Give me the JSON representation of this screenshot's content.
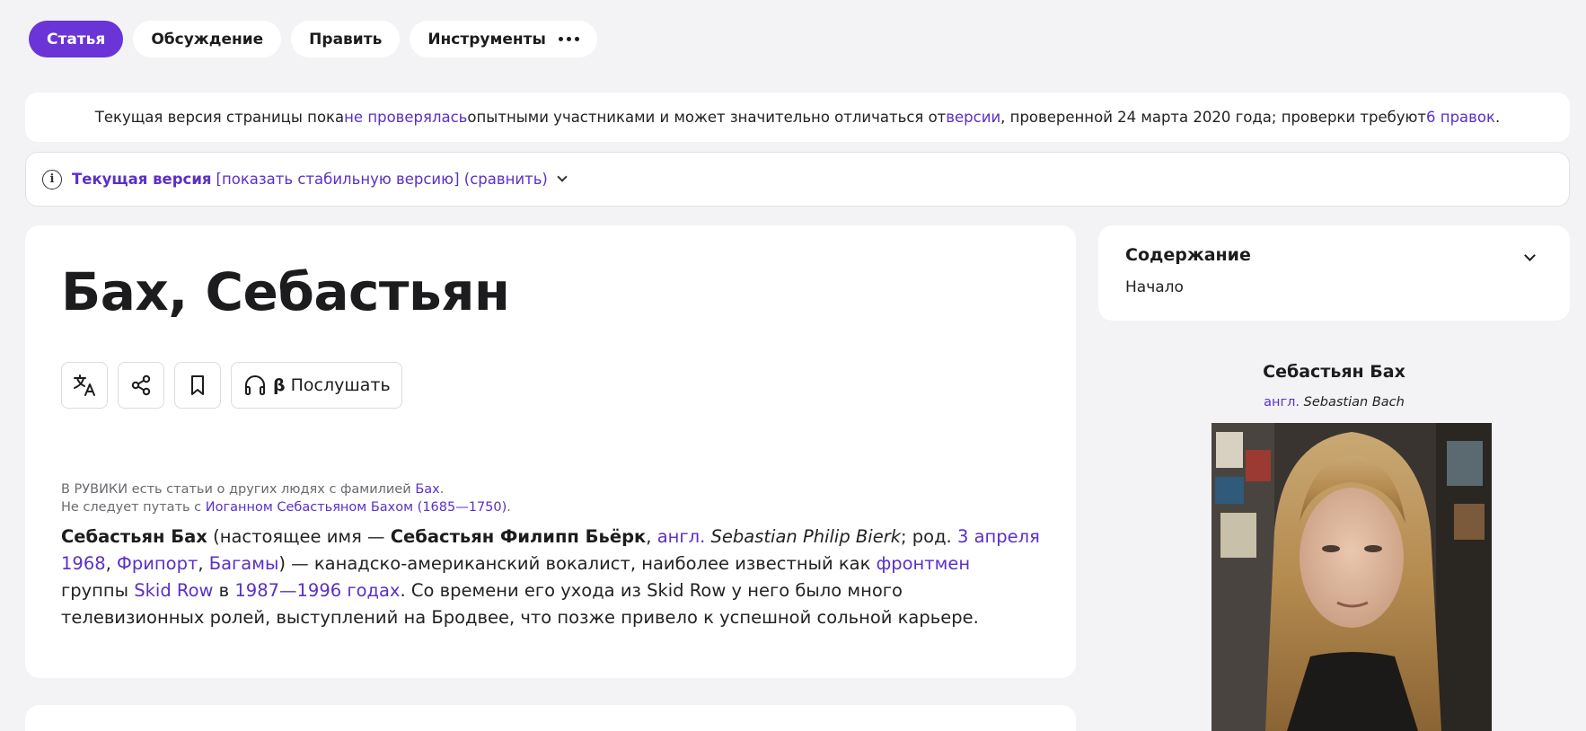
{
  "tabs": [
    {
      "label": "Статья",
      "active": true
    },
    {
      "label": "Обсуждение",
      "active": false
    },
    {
      "label": "Править",
      "active": false
    },
    {
      "label": "Инструменты",
      "active": false
    }
  ],
  "notice": {
    "part1": "Текущая версия страницы пока ",
    "link1": "не проверялась",
    "part2": " опытными участниками и может значительно отличаться от ",
    "link2": "версии",
    "part3": ", проверенной 24 марта 2020 года; проверки требуют ",
    "link3": "6 правок",
    "part4": "."
  },
  "version_bar": {
    "current": "Текущая версия",
    "bracket_open": "[",
    "stable_link": "показать стабильную версию",
    "bracket_close": "]",
    "paren_open": "(",
    "compare_link": "сравнить",
    "paren_close": ")"
  },
  "article": {
    "title": "Бах, Себастьян",
    "listen_beta": "β",
    "listen_label": "Послушать",
    "hatnote1_text": "В РУВИКИ есть статьи о других людях с фамилией ",
    "hatnote1_link": "Бах",
    "hatnote1_end": ".",
    "hatnote2_text": "Не следует путать с ",
    "hatnote2_link": "Иоганном Себастьяном Бахом (1685—1750)",
    "hatnote2_end": ".",
    "lead": {
      "name": "Себастьян Бах",
      "t1": " (настоящее имя — ",
      "real_name": "Себастьян Филипп Бьёрк",
      "t2": ", ",
      "lang": "англ.",
      "t3": " ",
      "eng_name": "Sebastian Philip Bierk",
      "t4": "; род. ",
      "birth": "3 апреля 1968",
      "t5": ", ",
      "place": "Фрипорт",
      "t6": ", ",
      "country": "Багамы",
      "t7": ") — канадско-американский вокалист, наиболее известный как ",
      "frontman": "фронтмен",
      "t8": " группы ",
      "band": "Skid Row",
      "t9": " в ",
      "years": "1987—1996 годах",
      "t10": ". Со времени его ухода из Skid Row у него было много телевизионных ролей, выступлений на Бродвее, что позже привело к успешной сольной карьере."
    }
  },
  "toc": {
    "title": "Содержание",
    "items": [
      "Начало"
    ]
  },
  "infobox": {
    "name": "Себастьян Бах",
    "lang": "англ.",
    "original_name": "Sebastian Bach"
  },
  "colors": {
    "accent": "#6a34d6",
    "link": "#5b2fc9",
    "background": "#f3f3f6"
  }
}
